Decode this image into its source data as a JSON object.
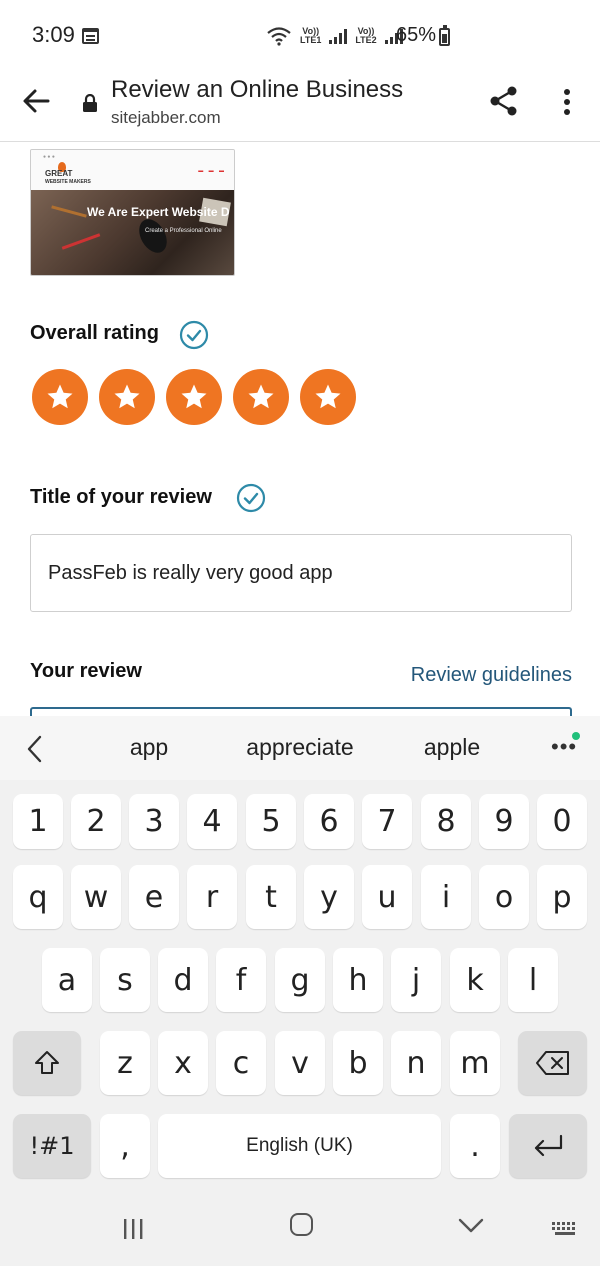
{
  "status": {
    "time": "3:09",
    "net1": "Vo))\nLTE1",
    "net2": "Vo))\nLTE2",
    "battery": "65%"
  },
  "app_bar": {
    "title": "Review an Online Business",
    "url": "sitejabber.com"
  },
  "thumbnail": {
    "logo_line1": "GREAT",
    "logo_line2": "WEBSITE MAKERS",
    "headline": "We Are Expert Website D",
    "sub": "Create a Professional Online"
  },
  "form": {
    "overall_label": "Overall rating",
    "rating": 5,
    "rating_max": 5,
    "title_label": "Title of your review",
    "title_value": "PassFeb is really very good app",
    "review_label": "Your review",
    "guidelines_link": "Review guidelines"
  },
  "keyboard": {
    "suggestions": [
      "app",
      "appreciate",
      "apple"
    ],
    "row_numbers": [
      "1",
      "2",
      "3",
      "4",
      "5",
      "6",
      "7",
      "8",
      "9",
      "0"
    ],
    "row1": [
      "q",
      "w",
      "e",
      "r",
      "t",
      "y",
      "u",
      "i",
      "o",
      "p"
    ],
    "row2": [
      "a",
      "s",
      "d",
      "f",
      "g",
      "h",
      "j",
      "k",
      "l"
    ],
    "row3": [
      "z",
      "x",
      "c",
      "v",
      "b",
      "n",
      "m"
    ],
    "symbols_key": "!#1",
    "comma_key": ",",
    "space_key": "English (UK)",
    "period_key": "."
  },
  "colors": {
    "accent": "#EF7522",
    "check": "#2E8AA8",
    "link": "#24577A"
  }
}
